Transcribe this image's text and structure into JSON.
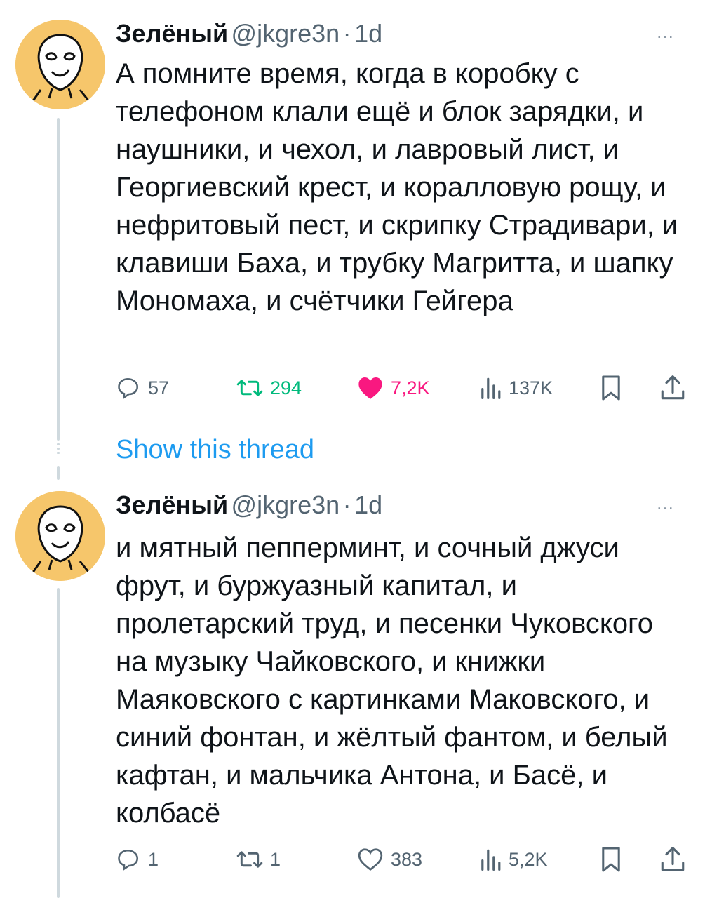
{
  "colors": {
    "link": "#1d9bf0",
    "retweet_active": "#00ba7c",
    "like_active": "#f91880",
    "muted": "#536471",
    "avatar_bg": "#f6c66b"
  },
  "tweets": [
    {
      "author": {
        "name": "Зелёный",
        "handle": "@jkgre3n",
        "avatar_icon": "alien-face-avatar"
      },
      "separator": "·",
      "time": "1d",
      "more_icon": "…",
      "text": "А помните время, когда в коробку с телефоном клали ещё и блок зарядки, и наушники, и чехол, и лавровый лист, и Георгиевский крест, и коралловую рощу, и нефритовый пест, и скрипку Страдивари, и клавиши Баха, и трубку Магритта, и шапку Мономаха, и счётчики Гейгера",
      "stats": {
        "replies": "57",
        "retweets": "294",
        "likes": "7,2K",
        "views": "137K"
      },
      "retweeted": true,
      "liked": true
    },
    {
      "author": {
        "name": "Зелёный",
        "handle": "@jkgre3n",
        "avatar_icon": "alien-face-avatar"
      },
      "separator": "·",
      "time": "1d",
      "more_icon": "…",
      "text": "и мятный пепперминт, и сочный джуси фрут, и буржуазный капитал, и пролетарский труд, и песенки Чуковского на музыку Чайковского, и книжки Маяковского с картинками Маковского, и синий фонтан, и жёлтый фантом, и белый кафтан, и мальчика Антона, и Басё, и колбасё",
      "stats": {
        "replies": "1",
        "retweets": "1",
        "likes": "383",
        "views": "5,2K"
      },
      "retweeted": false,
      "liked": false
    }
  ],
  "show_thread": "Show this thread"
}
